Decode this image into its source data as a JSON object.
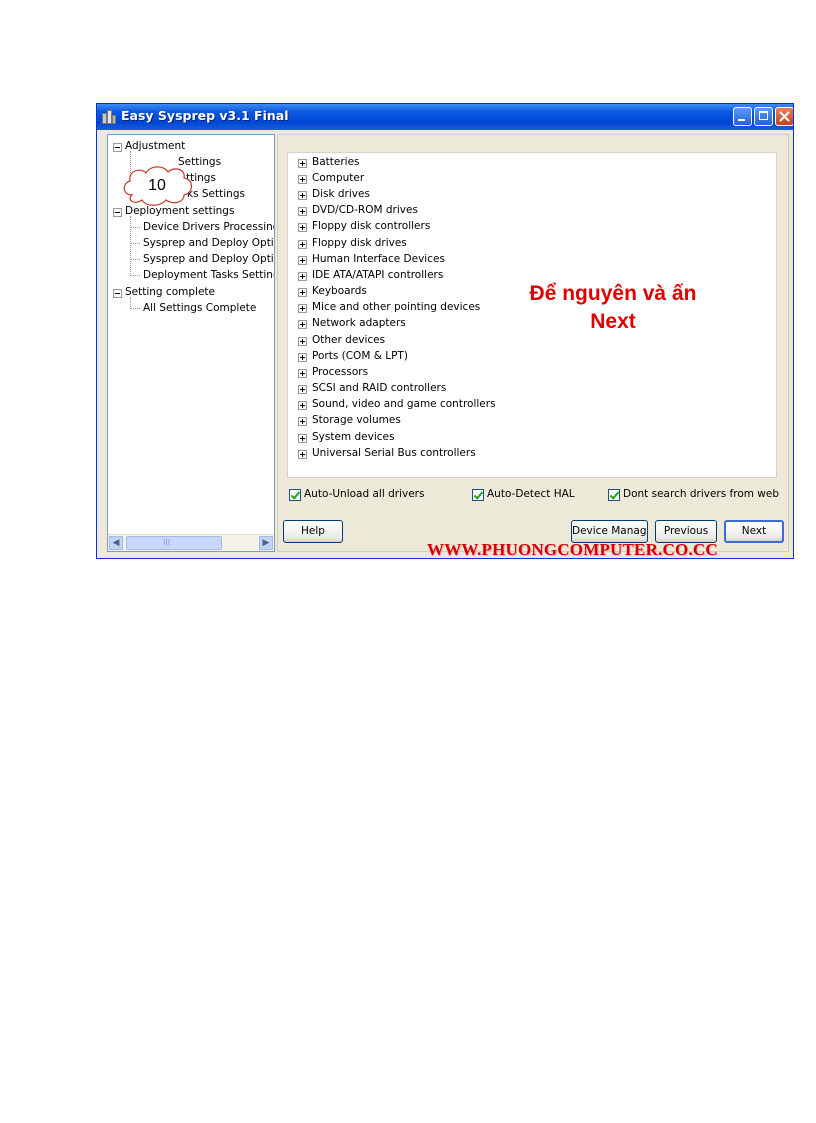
{
  "window": {
    "title": "Easy Sysprep v3.1 Final"
  },
  "tree": {
    "nodes": [
      {
        "label": "Adjustment"
      },
      {
        "label": "Settings"
      },
      {
        "label": "ttings"
      },
      {
        "label": "ks Settings"
      },
      {
        "label": "Deployment settings"
      },
      {
        "label": "Device Drivers Processing"
      },
      {
        "label": "Sysprep and Deploy Optio"
      },
      {
        "label": "Sysprep and Deploy Optio"
      },
      {
        "label": "Deployment Tasks Setting"
      },
      {
        "label": "Setting complete"
      },
      {
        "label": "All Settings Complete"
      }
    ],
    "scroll_thumb_label": "III"
  },
  "callout": {
    "number": "10"
  },
  "devices": {
    "items": [
      "Batteries",
      "Computer",
      "Disk drives",
      "DVD/CD-ROM drives",
      "Floppy disk controllers",
      "Floppy disk drives",
      "Human Interface Devices",
      "IDE ATA/ATAPI controllers",
      "Keyboards",
      "Mice and other pointing devices",
      "Network adapters",
      "Other devices",
      "Ports (COM & LPT)",
      "Processors",
      "SCSI and RAID controllers",
      "Sound, video and game controllers",
      "Storage volumes",
      "System devices",
      "Universal Serial Bus controllers"
    ]
  },
  "annotation": {
    "line1": "Để nguyên và ấn",
    "line2": "Next",
    "color": "#e00000"
  },
  "options": {
    "auto_unload": {
      "label": "Auto-Unload all drivers",
      "checked": true
    },
    "auto_detect": {
      "label": "Auto-Detect HAL",
      "checked": true
    },
    "dont_search": {
      "label": "Dont search drivers from web",
      "checked": true
    }
  },
  "buttons": {
    "help": "Help",
    "device_manager": "Device Manage",
    "previous": "Previous",
    "next": "Next"
  },
  "watermark": {
    "text": "WWW.PHUONGCOMPUTER.CO.CC"
  }
}
